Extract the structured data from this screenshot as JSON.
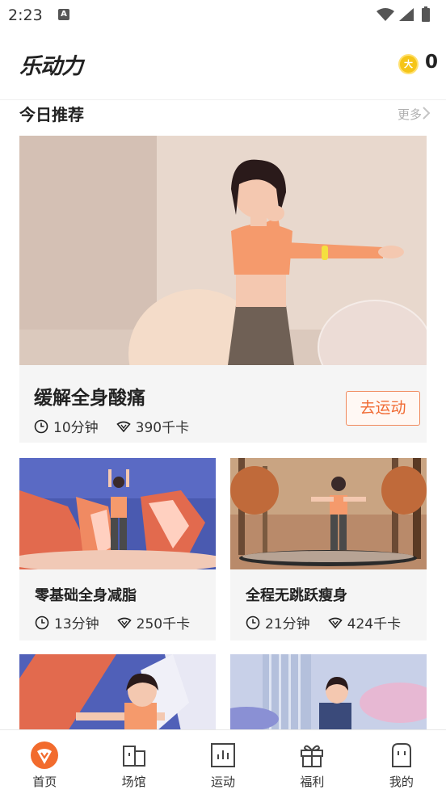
{
  "status_bar": {
    "time": "2:23",
    "a_badge": "A"
  },
  "header": {
    "app_title": "乐动力",
    "coin_symbol": "大",
    "coin_count": "0"
  },
  "recommend": {
    "title": "今日推荐",
    "more_label": "更多"
  },
  "featured": {
    "name": "缓解全身酸痛",
    "duration": "10分钟",
    "calories": "390千卡",
    "action_label": "去运动"
  },
  "workouts": [
    {
      "name": "零基础全身减脂",
      "duration": "13分钟",
      "calories": "250千卡"
    },
    {
      "name": "全程无跳跃瘦身",
      "duration": "21分钟",
      "calories": "424千卡"
    }
  ],
  "bottom_nav": [
    {
      "label": "首页",
      "icon": "home-logo-icon",
      "active": true
    },
    {
      "label": "场馆",
      "icon": "venue-icon",
      "active": false
    },
    {
      "label": "运动",
      "icon": "chart-icon",
      "active": false
    },
    {
      "label": "福利",
      "icon": "gift-icon",
      "active": false
    },
    {
      "label": "我的",
      "icon": "profile-icon",
      "active": false
    }
  ],
  "colors": {
    "accent": "#f06a33",
    "active_nav": "#f26b2d"
  }
}
